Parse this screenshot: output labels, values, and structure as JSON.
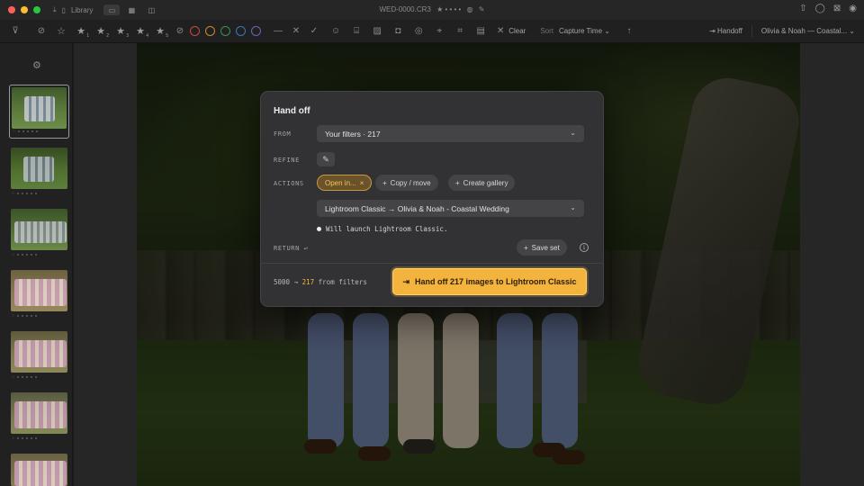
{
  "titlebar": {
    "library_label": "Library",
    "filename": "WED-0000.CR3",
    "colors": {
      "red": "#ff5f57",
      "yellow": "#febc2e",
      "green": "#28c840"
    }
  },
  "toolbar": {
    "star_counts": [
      "1",
      "2",
      "3",
      "4",
      "5"
    ],
    "label_colors": [
      "#c64a3e",
      "#c78a2e",
      "#3d8e4f",
      "#3a77b8",
      "#6c63c0"
    ],
    "clear_label": "Clear",
    "sort_label": "Sort",
    "sort_value": "Capture Time",
    "handoff_label": "Handoff",
    "project_label": "Olivia & Noah — Coastal..."
  },
  "modal": {
    "title": "Hand off",
    "from_label": "FROM",
    "from_value": "Your filters · 217",
    "refine_label": "REFINE",
    "actions_label": "ACTIONS",
    "action_open": "Open in...",
    "action_copy": "Copy / move",
    "action_gallery": "Create gallery",
    "target_value": "Lightroom Classic → Olivia & Noah - Coastal Wedding",
    "launch_note": "Will launch Lightroom Classic.",
    "return_label": "RETURN ↩",
    "save_set": "Save set",
    "count_total": "5000",
    "count_arrow": "→",
    "count_filtered": "217",
    "count_suffix": "from filters",
    "cta_label": "Hand off 217 images to Lightroom Classic",
    "accent": "#f4b33c"
  }
}
